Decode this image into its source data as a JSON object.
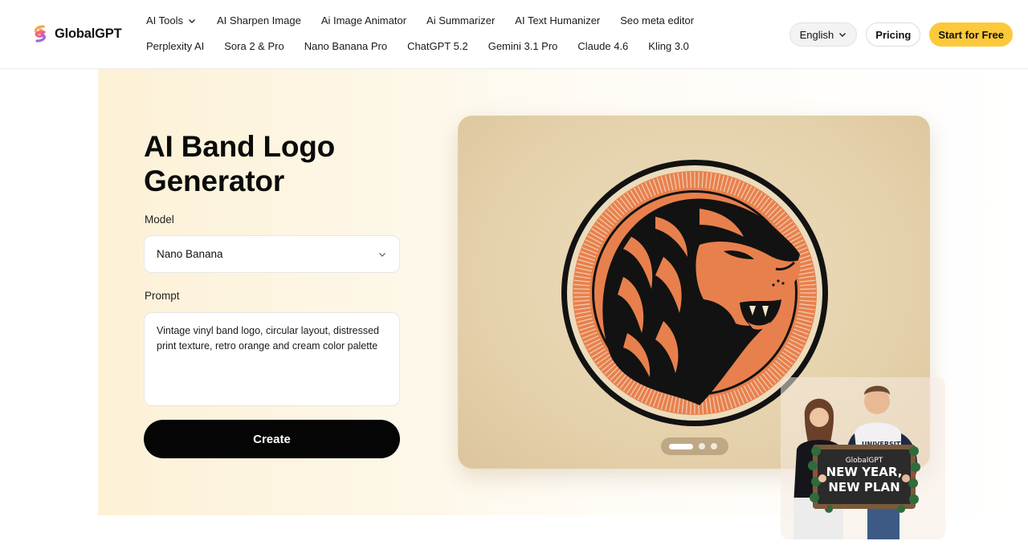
{
  "brand": {
    "name": "GlobalGPT",
    "logo_icon": "globalgpt-swirl-icon"
  },
  "nav": {
    "row1": [
      {
        "label": "AI Tools",
        "has_dropdown": true
      },
      {
        "label": "AI Sharpen Image"
      },
      {
        "label": "Ai Image Animator"
      },
      {
        "label": "Ai Summarizer"
      },
      {
        "label": "AI Text Humanizer"
      },
      {
        "label": "Seo meta editor"
      }
    ],
    "row2": [
      {
        "label": "Perplexity AI"
      },
      {
        "label": "Sora 2 & Pro"
      },
      {
        "label": "Nano Banana Pro"
      },
      {
        "label": "ChatGPT 5.2"
      },
      {
        "label": "Gemini 3.1 Pro"
      },
      {
        "label": "Claude 4.6"
      },
      {
        "label": "Kling 3.0"
      }
    ]
  },
  "header_actions": {
    "language": "English",
    "pricing": "Pricing",
    "start": "Start for Free"
  },
  "hero": {
    "title": "AI Band Logo Generator",
    "model_label": "Model",
    "model_value": "Nano Banana",
    "prompt_label": "Prompt",
    "prompt_value": "Vintage vinyl band logo, circular layout, distressed print texture, retro orange and cream color palette",
    "create_label": "Create"
  },
  "showcase": {
    "image_icon": "lion-vinyl-logo-image",
    "carousel": {
      "total": 3,
      "active": 1
    }
  },
  "promo": {
    "sign_brand": "GlobalGPT",
    "sign_line1": "NEW YEAR,",
    "sign_line2": "NEW PLAN",
    "shirt_text": "UNIVERSITY"
  },
  "colors": {
    "accent_yellow": "#fcc93a",
    "hero_bg": "#fdf1d6",
    "logo_orange": "#e8804d",
    "button_black": "#050505"
  }
}
